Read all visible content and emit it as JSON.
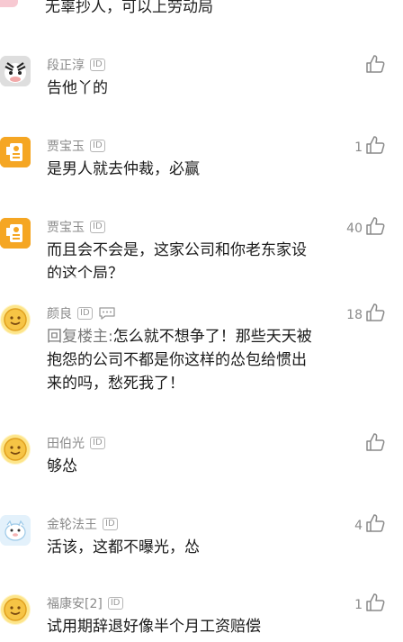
{
  "top_snippet": "无辜抄人，可以上劳动局",
  "comments": [
    {
      "name": "段正淳",
      "id_badge": "ID",
      "text": "告他丫的",
      "likes": ""
    },
    {
      "name": "贾宝玉",
      "id_badge": "ID",
      "text": "是男人就去仲裁，必赢",
      "likes": "1"
    },
    {
      "name": "贾宝玉",
      "id_badge": "ID",
      "text_line1": "而且会不会是，这家公司和你老东家设",
      "text_line2": "的这个局？",
      "likes": "40"
    },
    {
      "name": "颜良",
      "id_badge": "ID",
      "reply_prefix": "回复楼主:",
      "text_line1": "怎么就不想争了！那些天天被",
      "text_line2": "抱怨的公司不都是你这样的怂包给惯出",
      "text_line3": "来的吗，愁死我了！",
      "likes": "18"
    },
    {
      "name": "田伯光",
      "id_badge": "ID",
      "text": "够怂",
      "likes": ""
    },
    {
      "name": "金轮法王",
      "id_badge": "ID",
      "text": "活该，这都不曝光，怂",
      "likes": "4"
    },
    {
      "name": "福康安[2]",
      "id_badge": "ID",
      "text": "试用期辞退好像半个月工资赔偿",
      "likes": "1"
    }
  ]
}
